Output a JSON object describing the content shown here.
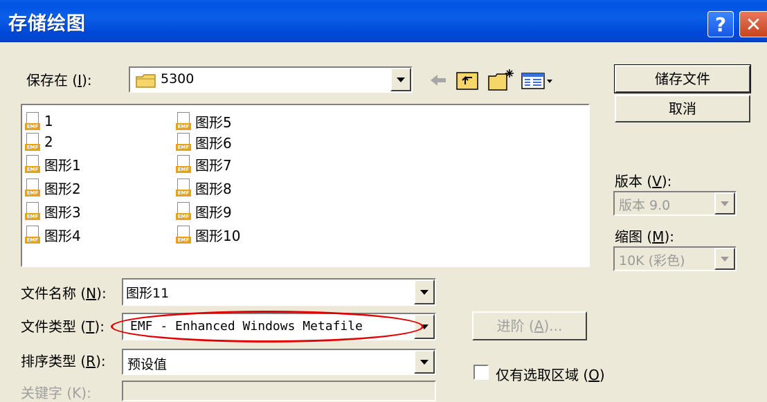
{
  "window": {
    "title": "存储绘图",
    "help_glyph": "?",
    "close_glyph": "✕"
  },
  "save_in": {
    "label_prefix": "保存在 (",
    "label_key": "I",
    "label_suffix": "):",
    "value": "5300"
  },
  "files": [
    {
      "name": "1"
    },
    {
      "name": "2"
    },
    {
      "name": "图形1"
    },
    {
      "name": "图形2"
    },
    {
      "name": "图形3"
    },
    {
      "name": "图形4"
    },
    {
      "name": "图形5"
    },
    {
      "name": "图形6"
    },
    {
      "name": "图形7"
    },
    {
      "name": "图形8"
    },
    {
      "name": "图形9"
    },
    {
      "name": "图形10"
    }
  ],
  "file_icon_tag": "EMF",
  "filename": {
    "label_prefix": "文件名称 (",
    "label_key": "N",
    "label_suffix": "):",
    "value": "图形11"
  },
  "filetype": {
    "label_prefix": "文件类型 (",
    "label_key": "T",
    "label_suffix": "):",
    "value": "EMF - Enhanced Windows Metafile"
  },
  "sorttype": {
    "label_prefix": "排序类型 (",
    "label_key": "R",
    "label_suffix": "):",
    "value": "预设值"
  },
  "keyword": {
    "label": "关键字 (K):"
  },
  "buttons": {
    "save": "储存文件",
    "cancel": "取消",
    "advanced_prefix": "进阶 (",
    "advanced_key": "A",
    "advanced_suffix": ")..."
  },
  "version": {
    "label_prefix": "版本 (",
    "label_key": "V",
    "label_suffix": "):",
    "value": "版本 9.0"
  },
  "thumbnail": {
    "label_prefix": "缩图 (",
    "label_key": "M",
    "label_suffix": "):",
    "value": "10K (彩色)"
  },
  "selected_only": {
    "label_prefix": "仅有选取区域 (",
    "label_key": "O",
    "label_suffix": ")"
  },
  "colors": {
    "titlebar": "#0054e3",
    "dialog_bg": "#ece9d8",
    "annotation_red": "#e00000"
  }
}
